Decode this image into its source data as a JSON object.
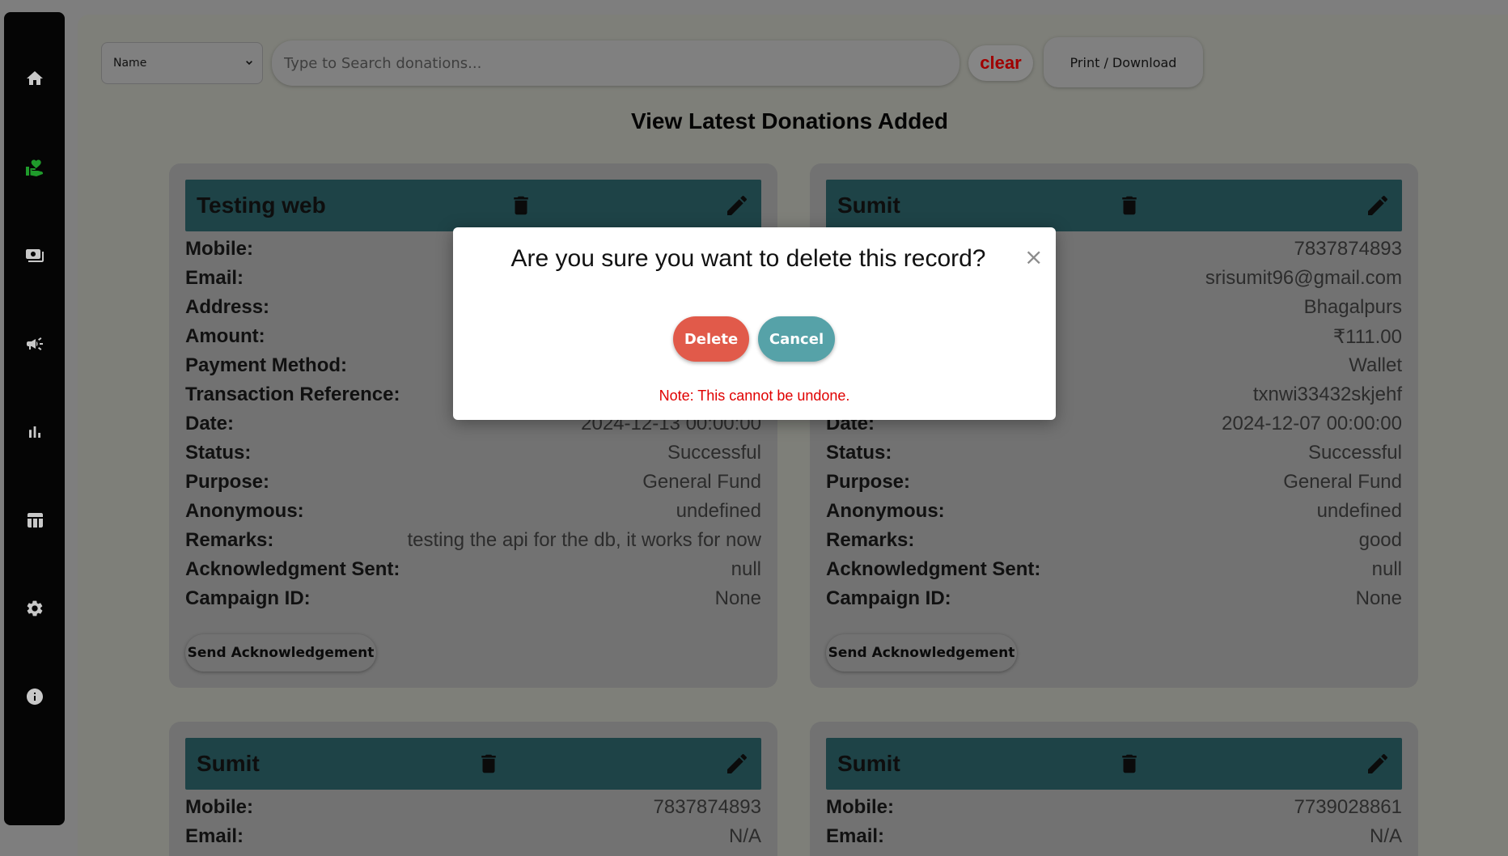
{
  "sidebar": {
    "items": [
      {
        "icon": "home-icon"
      },
      {
        "icon": "donate-icon",
        "active": true
      },
      {
        "icon": "payments-icon"
      },
      {
        "icon": "campaign-icon"
      },
      {
        "icon": "bar-chart-icon"
      },
      {
        "icon": "table-icon"
      },
      {
        "icon": "gear-icon"
      },
      {
        "icon": "info-icon"
      }
    ]
  },
  "toolbar": {
    "filter_selected": "Name",
    "search_placeholder": "Type to Search donations...",
    "clear_label": "clear",
    "print_label": "Print / Download"
  },
  "page_title": "View Latest Donations Added",
  "labels": {
    "mobile": "Mobile:",
    "email": "Email:",
    "address": "Address:",
    "amount": "Amount:",
    "payment_method": "Payment Method:",
    "transaction_reference": "Transaction Reference:",
    "date": "Date:",
    "status": "Status:",
    "purpose": "Purpose:",
    "anonymous": "Anonymous:",
    "remarks": "Remarks:",
    "ack_sent": "Acknowledgment Sent:",
    "campaign_id": "Campaign ID:"
  },
  "cards": [
    {
      "name": "Testing web",
      "date": "2024-12-13 00:00:00",
      "status": "Successful",
      "purpose": "General Fund",
      "anonymous": "undefined",
      "remarks": "testing the api for the db, it works for now",
      "ack_sent": "null",
      "campaign_id": "None",
      "ack_button": "Send Acknowledgement"
    },
    {
      "name": "Sumit",
      "mobile": "7837874893",
      "email": "srisumit96@gmail.com",
      "address": "Bhagalpurs",
      "amount": "₹111.00",
      "payment_method": "Wallet",
      "transaction_reference": "txnwi33432skjehf",
      "date": "2024-12-07 00:00:00",
      "status": "Successful",
      "purpose": "General Fund",
      "anonymous": "undefined",
      "remarks": "good",
      "ack_sent": "null",
      "campaign_id": "None",
      "ack_button": "Send Acknowledgement"
    },
    {
      "name": "Sumit",
      "mobile": "7837874893",
      "email": "N/A"
    },
    {
      "name": "Sumit",
      "mobile": "7739028861",
      "email": "N/A"
    }
  ],
  "modal": {
    "title": "Are you sure you want to delete this record?",
    "close": "×",
    "delete_label": "Delete",
    "cancel_label": "Cancel",
    "note": "Note: This cannot be undone."
  },
  "colors": {
    "card_header": "#1e4347",
    "delete_button": "#e15a4a",
    "cancel_button": "#56a2a8",
    "note_text": "#e00000",
    "active_icon": "#1f9b2b"
  }
}
